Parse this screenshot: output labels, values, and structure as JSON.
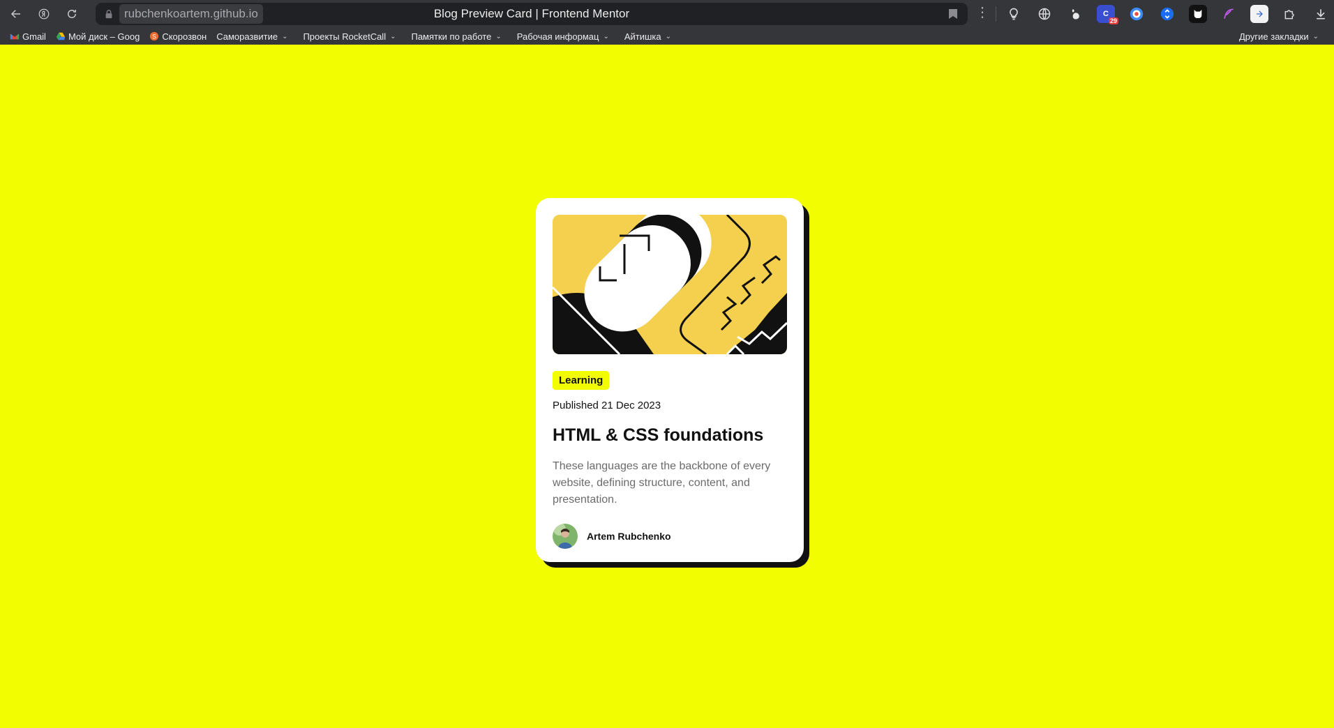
{
  "browser": {
    "url": "rubchenkoartem.github.io",
    "tab_title": "Blog Preview Card | Frontend Mentor",
    "bookmarks": [
      {
        "label": "Gmail",
        "folder": false
      },
      {
        "label": "Мой диск – Goog",
        "folder": false
      },
      {
        "label": "Скорозвон",
        "folder": false
      },
      {
        "label": "Саморазвитие",
        "folder": true
      },
      {
        "label": "Проекты RocketCall",
        "folder": true
      },
      {
        "label": "Памятки по работе",
        "folder": true
      },
      {
        "label": "Рабочая информац",
        "folder": true
      },
      {
        "label": "Айтишка",
        "folder": true
      }
    ],
    "other_bookmarks": "Другие закладки",
    "calendar_badge": "29",
    "colors": {
      "chrome": "#35363a",
      "address_bar": "#202124",
      "page_bg": "#f3fd02"
    }
  },
  "card": {
    "tag": "Learning",
    "published": "Published 21 Dec 2023",
    "title": "HTML & CSS foundations",
    "description": "These languages are the backbone of every website, defining structure, content, and presentation.",
    "author": "Artem Rubchenko",
    "colors": {
      "background": "#ffffff",
      "shadow": "#111111",
      "tag_bg": "#f3fd02",
      "illustration_bg": "#f4d04e"
    }
  }
}
